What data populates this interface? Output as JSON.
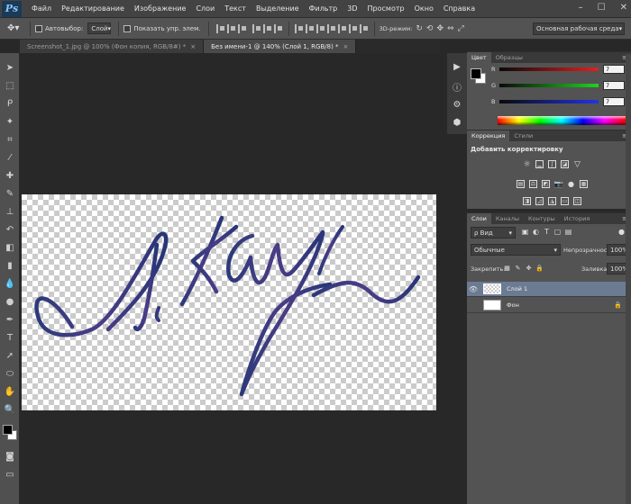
{
  "app": {
    "logo": "Ps"
  },
  "menu": [
    "Файл",
    "Редактирование",
    "Изображение",
    "Слои",
    "Текст",
    "Выделение",
    "Фильтр",
    "3D",
    "Просмотр",
    "Окно",
    "Справка"
  ],
  "window_controls": {
    "minimize": "–",
    "maximize": "☐",
    "close": "✕"
  },
  "options": {
    "autoselect_label": "Автовыбор:",
    "autoselect_target": "Слой",
    "autoselect_checked": false,
    "show_transform_label": "Показать упр. элем.",
    "show_transform_checked": false,
    "mode3d_label": "3D-режим:",
    "workspace": "Основная рабочая среда"
  },
  "tabs": [
    {
      "title": "Screenshot_1.jpg @ 100% (Фон копия, RGB/8#) *",
      "close": "×",
      "active": false
    },
    {
      "title": "Без имени-1 @ 140% (Слой 1, RGB/8) *",
      "close": "×",
      "active": true
    }
  ],
  "color_panel": {
    "tabs": [
      "Цвет",
      "Образцы"
    ],
    "channels": [
      {
        "label": "R",
        "value": "7",
        "color": "#e32020"
      },
      {
        "label": "G",
        "value": "7",
        "color": "#1fd31f"
      },
      {
        "label": "B",
        "value": "7",
        "color": "#2133e6"
      }
    ],
    "fg_color": "#000000",
    "bg_color": "#ffffff"
  },
  "adjust_panel": {
    "tabs": [
      "Коррекция",
      "Стили"
    ],
    "title": "Добавить корректировку"
  },
  "layers_panel": {
    "tabs": [
      "Слои",
      "Каналы",
      "Контуры",
      "История"
    ],
    "kind": "ρ Вид",
    "blend_mode": "Обычные",
    "opacity_label": "Непрозрачность:",
    "opacity": "100%",
    "lock_label": "Закрепить:",
    "fill_label": "Заливка:",
    "fill": "100%",
    "layers": [
      {
        "name": "Слой 1",
        "selected": true,
        "visible": true,
        "locked": false
      },
      {
        "name": "Фон",
        "selected": false,
        "visible": false,
        "locked": true
      }
    ]
  },
  "icons": {
    "panel_menu": "≡",
    "eye": "👁",
    "lock": "🔒",
    "dropdown": "▾",
    "close_tab": "×"
  }
}
